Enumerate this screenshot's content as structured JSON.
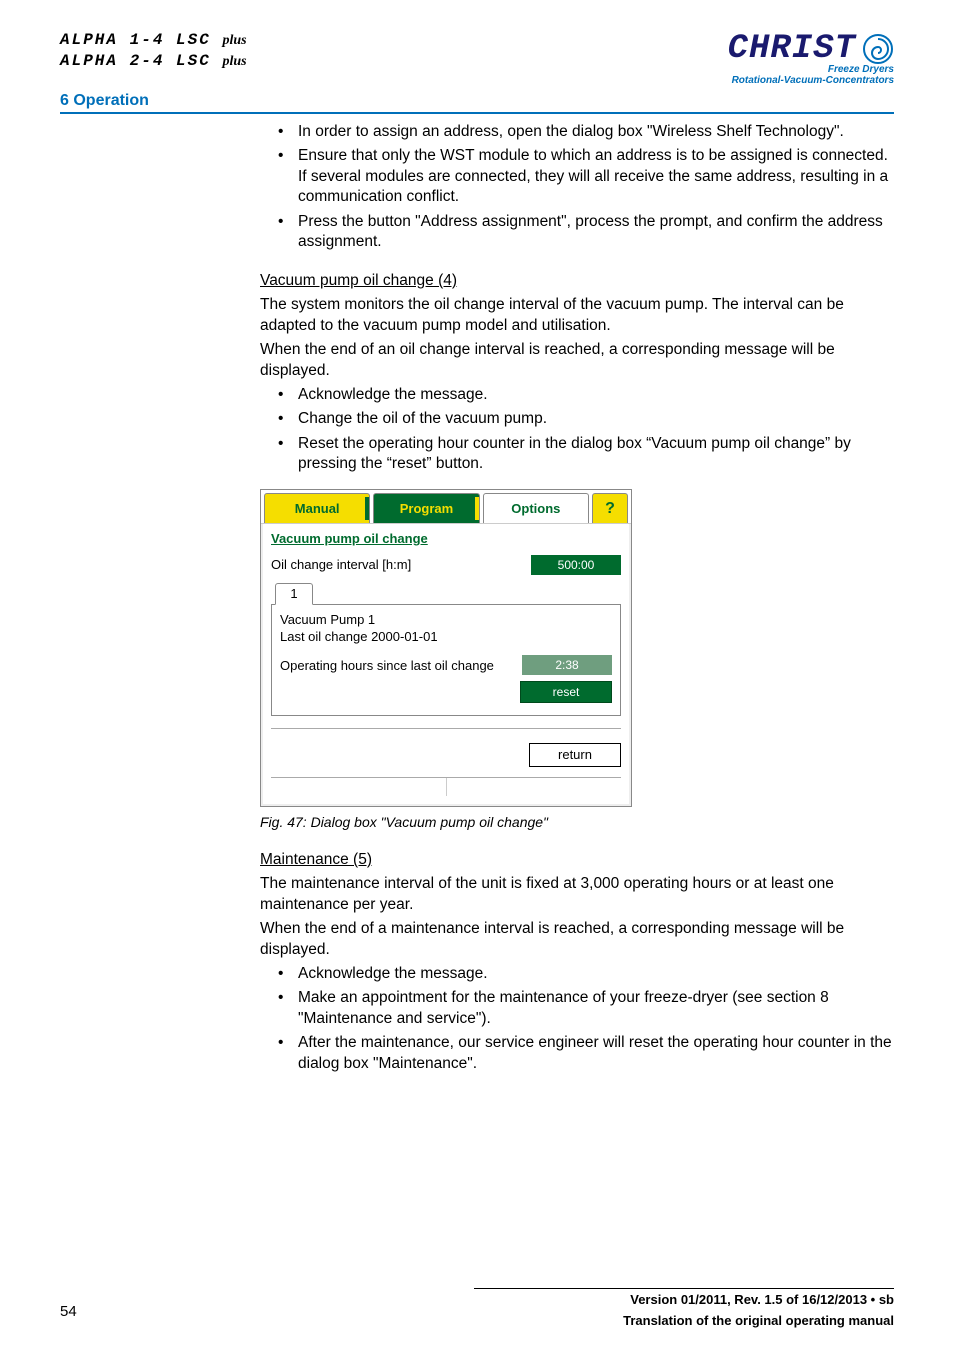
{
  "header": {
    "product1_a": "ALPHA 1-4 LSC",
    "product1_b": "plus",
    "product2_a": "ALPHA 2-4 LSC",
    "product2_b": "plus",
    "section": "6 Operation",
    "brand": "CHRIST",
    "tag1": "Freeze Dryers",
    "tag2": "Rotational-Vacuum-Concentrators"
  },
  "bullets_top": [
    "In order to assign an address, open the dialog box \"Wireless Shelf Technology\".",
    "Ensure that only the WST module to which an address is to be assigned is connected. If several modules are connected, they will all receive the same address, resulting in a communication conflict.",
    "Press the button \"Address assignment\", process the prompt, and confirm the address assignment."
  ],
  "vac_head": "Vacuum pump oil change (4)",
  "vac_p1": "The system monitors the oil change interval of the vacuum pump. The interval can be adapted to the vacuum pump model and utilisation.",
  "vac_p2": "When the end of an oil change interval is reached, a corresponding message will be displayed.",
  "vac_bullets": [
    "Acknowledge the message.",
    "Change the oil of the vacuum pump.",
    "Reset the operating hour counter in the dialog box “Vacuum pump oil change” by pressing the “reset” button."
  ],
  "dialog": {
    "tab_manual": "Manual",
    "tab_program": "Program",
    "tab_options": "Options",
    "tab_help": "?",
    "title": "Vacuum pump oil change",
    "interval_label": "Oil change interval [h:m]",
    "interval_value": "500:00",
    "pump_tab": "1",
    "pump_name": "Vacuum Pump 1",
    "last_change": "Last oil change 2000-01-01",
    "ophours_label": "Operating hours since last oil change",
    "ophours_value": "2:38",
    "reset": "reset",
    "return": "return"
  },
  "fig_caption": "Fig. 47: Dialog box \"Vacuum pump oil change\"",
  "maint_head": "Maintenance (5)",
  "maint_p1": "The maintenance interval of the unit is fixed at 3,000 operating hours or at least one maintenance per year.",
  "maint_p2": "When the end of a maintenance interval is reached, a corresponding message will be displayed.",
  "maint_bullets": [
    "Acknowledge the message.",
    "Make an appointment for the maintenance of your freeze-dryer (see section 8 \"Maintenance and service\").",
    "After the maintenance, our service engineer will reset the operating hour counter in the dialog box \"Maintenance\"."
  ],
  "footer": {
    "version": "Version 01/2011, Rev. 1.5 of 16/12/2013 • sb",
    "translation": "Translation of the original operating manual",
    "page": "54"
  }
}
